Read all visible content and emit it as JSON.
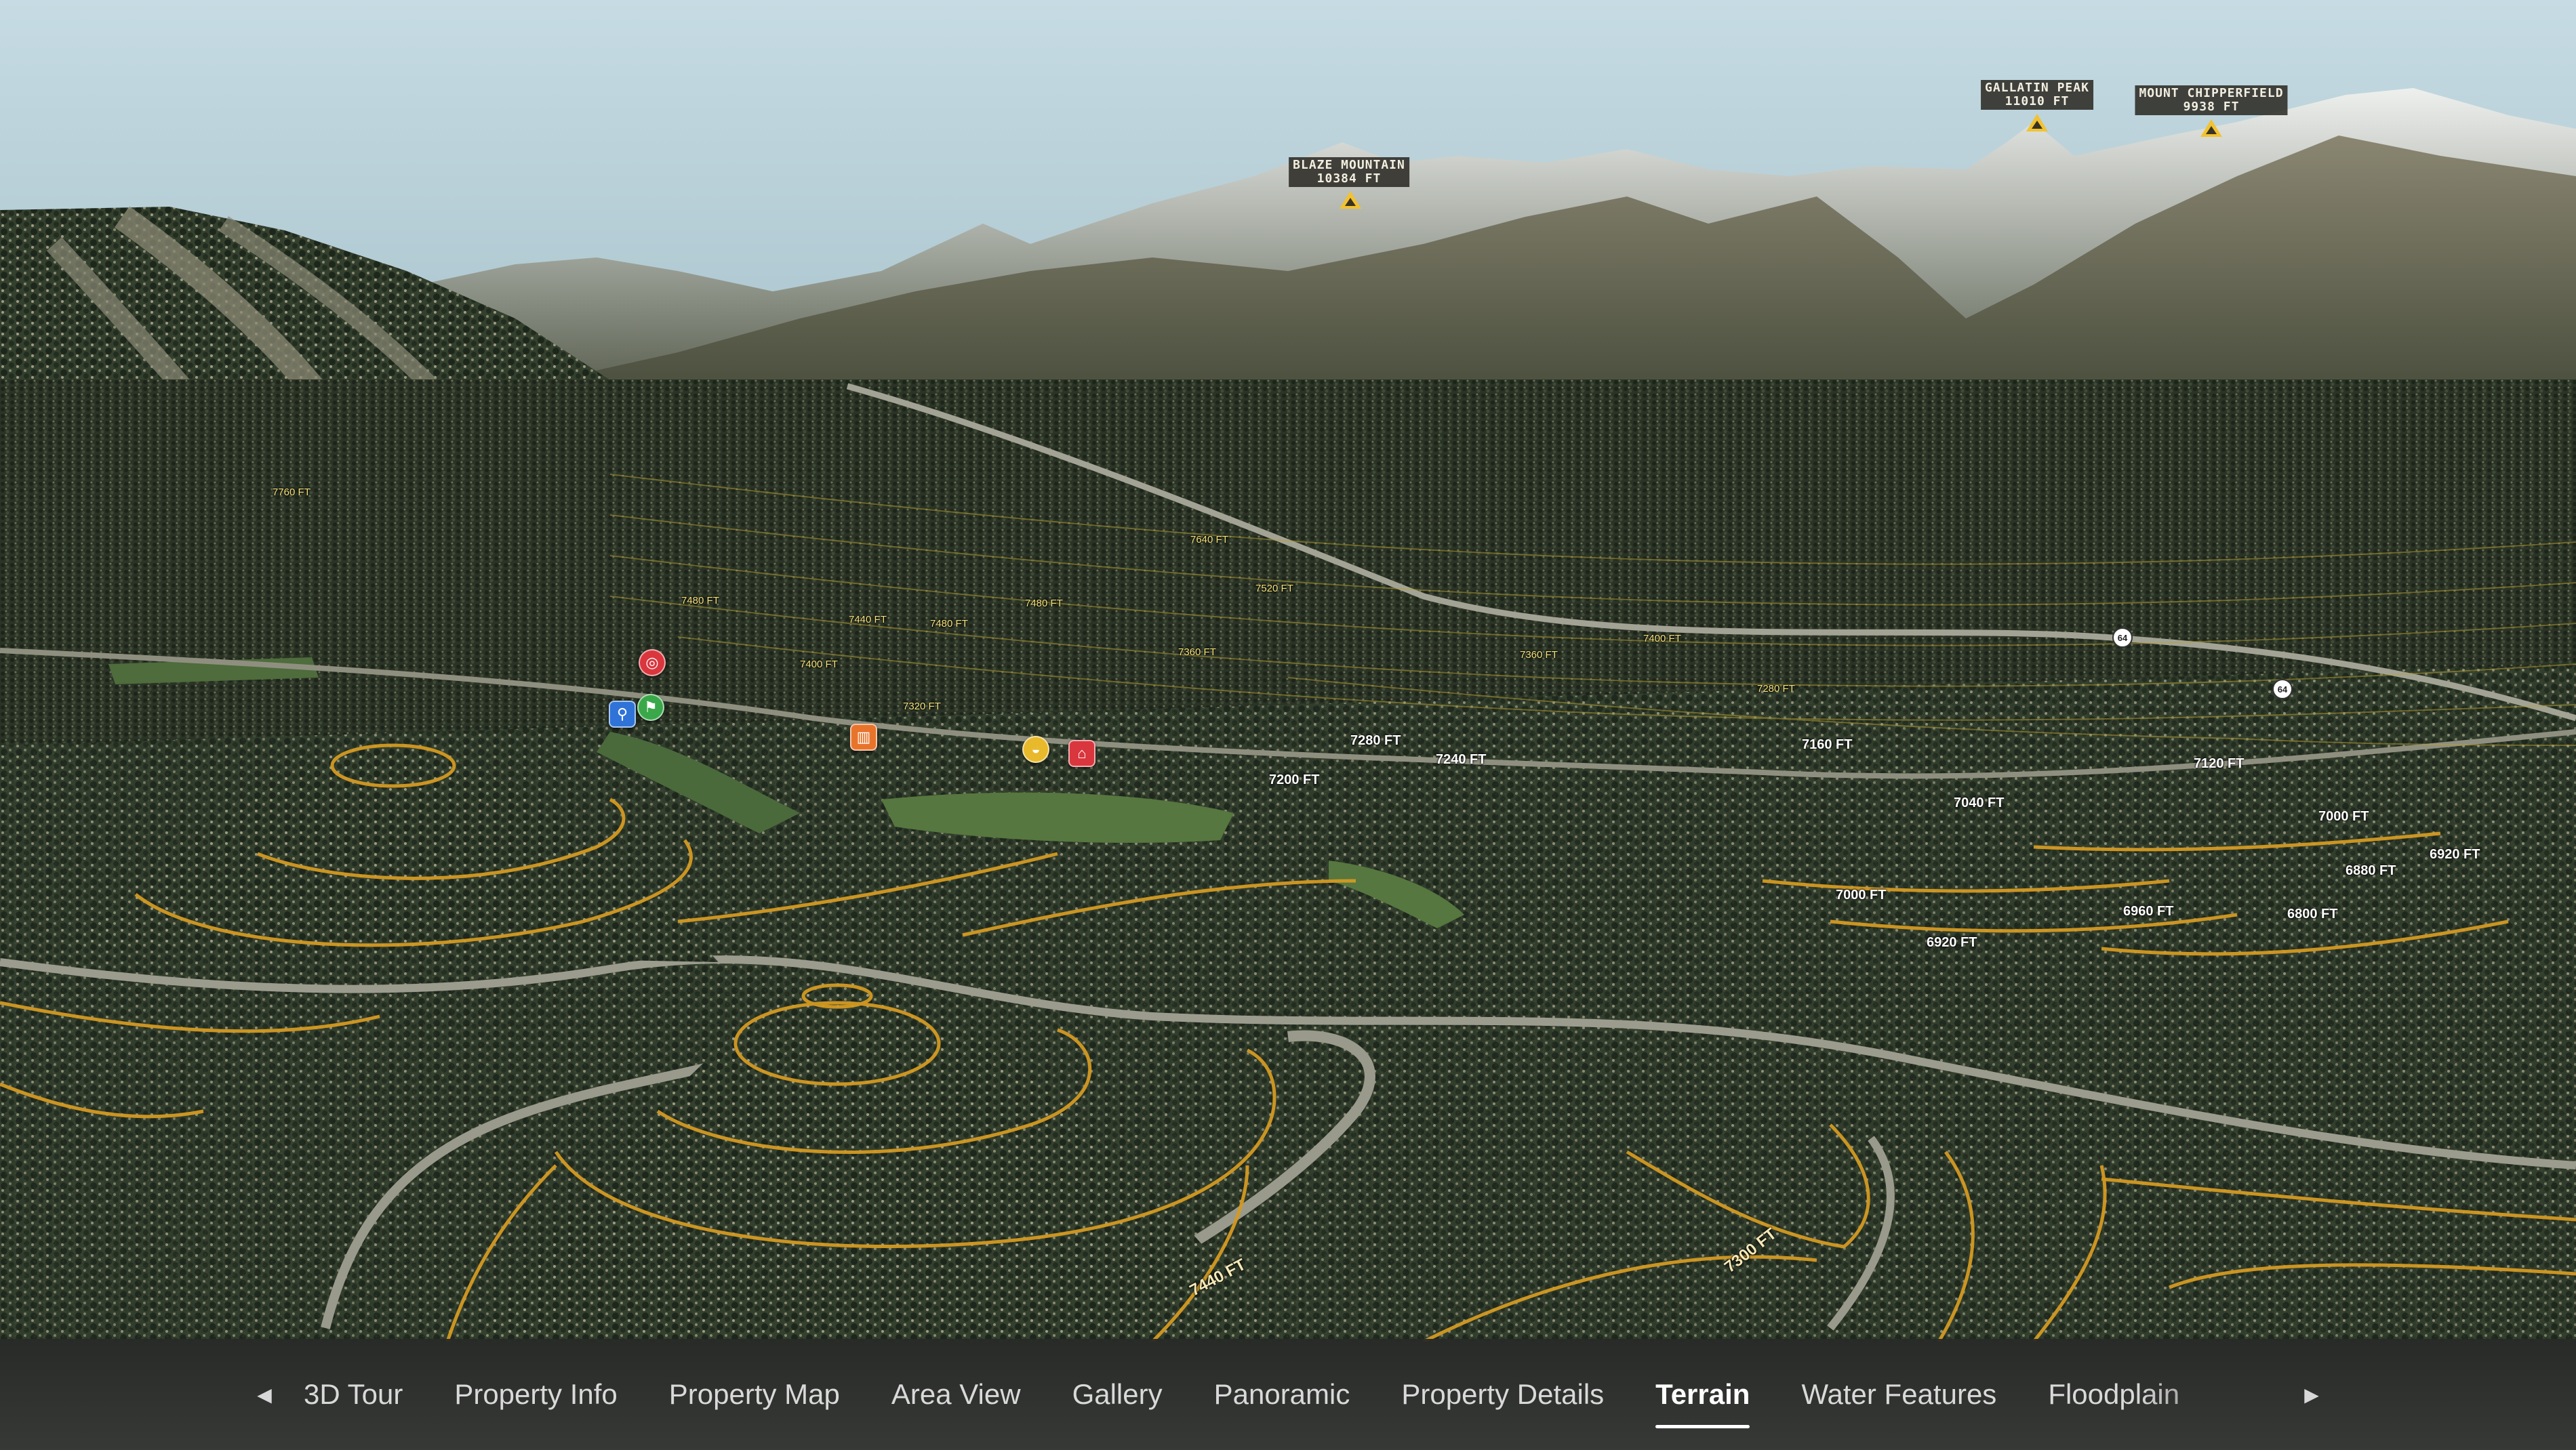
{
  "peaks": [
    {
      "name": "BLAZE MOUNTAIN",
      "elevation": "10384 FT"
    },
    {
      "name": "GALLATIN PEAK",
      "elevation": "11010 FT"
    },
    {
      "name": "MOUNT CHIPPERFIELD",
      "elevation": "9938 FT"
    }
  ],
  "contours": {
    "c7440a": "7440 FT",
    "c7480a": "7480 FT",
    "c7480b": "7480 FT",
    "c7400a": "7400 FT",
    "c7320": "7320 FT",
    "c7360a": "7360 FT",
    "c7520": "7520 FT",
    "c7360b": "7360 FT",
    "c7400b": "7400 FT",
    "c7280a": "7280 FT",
    "c7280b": "7280 FT",
    "c7240": "7240 FT",
    "c7200": "7200 FT",
    "c7160": "7160 FT",
    "c7120": "7120 FT",
    "c7040": "7040 FT",
    "c7000a": "7000 FT",
    "c7000b": "7000 FT",
    "c6960": "6960 FT",
    "c6920a": "6920 FT",
    "c6920b": "6920 FT",
    "c6880": "6880 FT",
    "c6800": "6800 FT",
    "c7640": "7640 FT",
    "c7440b": "7440 FT",
    "c7300": "7300 FT",
    "c7760": "7760 FT"
  },
  "hwy": {
    "a": "64",
    "b": "64"
  },
  "pois": {
    "target_icon": "target-icon",
    "bike_icon": "bike-icon",
    "golf_icon": "golf-icon",
    "lodging_icon": "lodging-icon",
    "food_icon": "food-icon",
    "shop_icon": "shop-icon"
  },
  "tabs": {
    "prev_icon": "◀",
    "next_icon": "▶",
    "items": [
      {
        "label": "3D Tour"
      },
      {
        "label": "Property Info"
      },
      {
        "label": "Property Map"
      },
      {
        "label": "Area View"
      },
      {
        "label": "Gallery"
      },
      {
        "label": "Panoramic"
      },
      {
        "label": "Property Details"
      },
      {
        "label": "Terrain"
      },
      {
        "label": "Water Features"
      },
      {
        "label": "Floodplain"
      }
    ],
    "active": "Terrain"
  },
  "colors": {
    "sky": "#bfd6df",
    "forest": "#2b3527",
    "contour": "#d49a22",
    "active_tab": "#ffffff"
  }
}
